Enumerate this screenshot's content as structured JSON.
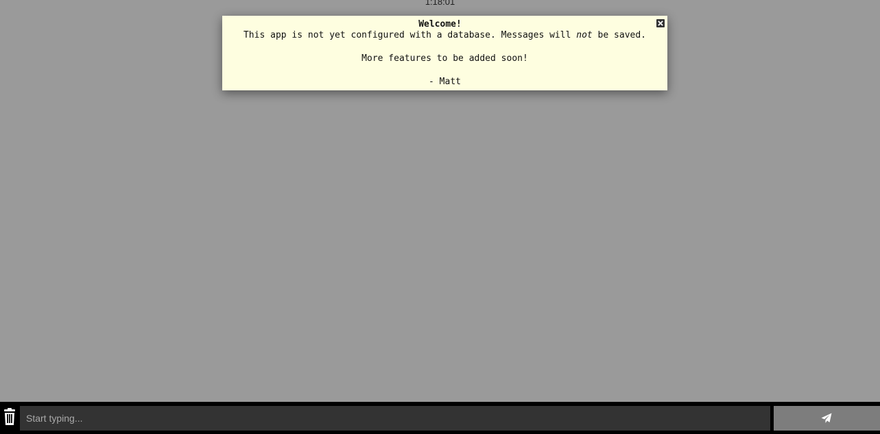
{
  "clock": {
    "time": "1:18:01"
  },
  "notice": {
    "title": "Welcome!",
    "line1_before": "This app is not yet configured with a database. Messages will ",
    "line1_emphasis": "not",
    "line1_after": " be saved.",
    "line2": "More features to be added soon!",
    "signature": "- Matt",
    "close_icon": "close-icon",
    "background_color": "#fefee0"
  },
  "composer": {
    "placeholder": "Start typing...",
    "value": "",
    "clear_icon": "trash-icon",
    "send_icon": "paper-plane-icon"
  },
  "colors": {
    "page_background": "#9a9a9a",
    "bar_background": "#000000",
    "input_background": "#333333",
    "send_button_background": "#7d7d7d"
  }
}
